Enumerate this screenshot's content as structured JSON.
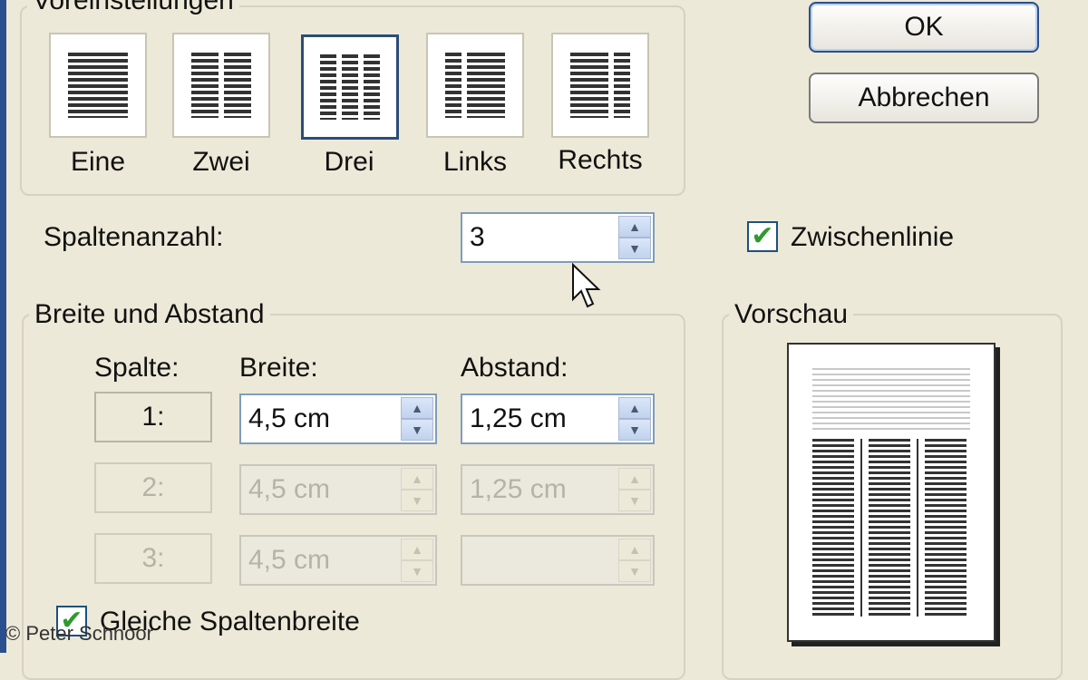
{
  "dialog": {
    "presets_group_title": "Voreinstellungen",
    "presets": [
      {
        "label": "Eine",
        "selected": false
      },
      {
        "label": "Zwei",
        "selected": false
      },
      {
        "label": "Drei",
        "selected": true
      },
      {
        "label": "Links",
        "selected": false
      },
      {
        "label": "Rechts",
        "selected": false
      }
    ],
    "ok_label": "OK",
    "cancel_label": "Abbrechen",
    "column_count_label": "Spaltenanzahl:",
    "column_count_value": "3",
    "separator_label": "Zwischenlinie",
    "separator_checked": true,
    "width_spacing_title": "Breite und Abstand",
    "col_header": "Spalte:",
    "width_header": "Breite:",
    "spacing_header": "Abstand:",
    "rows": [
      {
        "col": "1:",
        "width": "4,5 cm",
        "spacing": "1,25 cm",
        "enabled": true
      },
      {
        "col": "2:",
        "width": "4,5 cm",
        "spacing": "1,25 cm",
        "enabled": false
      },
      {
        "col": "3:",
        "width": "4,5 cm",
        "spacing": "",
        "enabled": false
      }
    ],
    "equal_width_label": "Gleiche Spaltenbreite",
    "equal_width_checked": true,
    "preview_title": "Vorschau"
  },
  "copyright": "© Peter Schnoor",
  "colors": {
    "background": "#ece9d8",
    "accent": "#2d4f87",
    "check": "#2e9a2e"
  }
}
